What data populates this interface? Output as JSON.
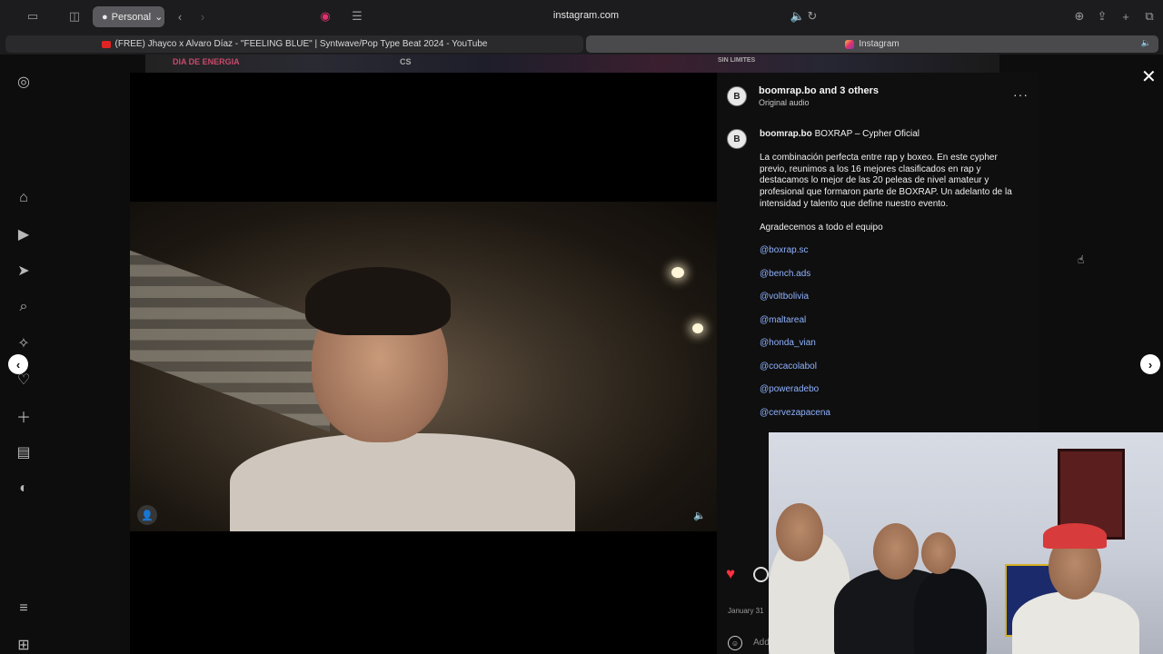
{
  "browser": {
    "profile_label": "Personal",
    "url": "instagram.com",
    "tabs": [
      {
        "label": "(FREE) Jhayco x Alvaro Díaz - \"FEELING BLUE\" | Syntwave/Pop Type Beat 2024 - YouTube",
        "active": false
      },
      {
        "label": "Instagram",
        "active": true
      }
    ]
  },
  "strip_texts": [
    "DIA DE ENERGIA",
    "CS",
    "SIN LIMITES"
  ],
  "post": {
    "author": "boomrap.bo",
    "and_others": "and 3 others",
    "audio": "Original audio",
    "caption_user": "boomrap.bo",
    "caption_title": "BOXRAP – Cypher Oficial",
    "caption_body": "La combinación perfecta entre rap y boxeo. En este cypher previo, reunimos a los 16 mejores clasificados en rap y destacamos lo mejor de las 20 peleas de nivel amateur y profesional que formaron parte de BOXRAP. Un adelanto de la intensidad y talento que define nuestro evento.",
    "thanks": "Agradecemos a todo el equipo",
    "mentions": [
      "@boxrap.sc",
      "@bench.ads",
      "@voltbolivia",
      "@maltareal",
      "@honda_vian",
      "@cocacolabol",
      "@poweradebo",
      "@cervezapacena"
    ],
    "date": "January 31",
    "add_comment": "Add"
  },
  "colors": {
    "accent_like": "#ff3040",
    "mention": "#8fb2ff"
  }
}
